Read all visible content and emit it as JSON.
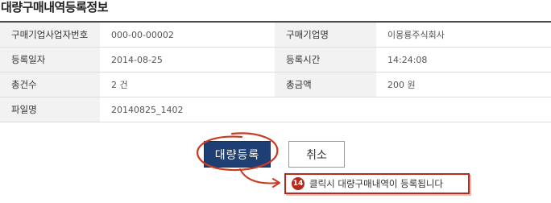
{
  "page": {
    "title": "대량구매내역등록정보"
  },
  "info": {
    "rows": [
      [
        {
          "label": "구매기업사업자번호",
          "value": "000-00-00002"
        },
        {
          "label": "구매기업명",
          "value": "이몽룡주식회사"
        }
      ],
      [
        {
          "label": "등록일자",
          "value": "2014-08-25"
        },
        {
          "label": "등록시간",
          "value": "14:24:08"
        }
      ],
      [
        {
          "label": "총건수",
          "value": "2 건"
        },
        {
          "label": "총금액",
          "value": "200 원"
        }
      ],
      [
        {
          "label": "파일명",
          "value": "20140825_1402"
        }
      ]
    ]
  },
  "actions": {
    "register_label": "대량등록",
    "cancel_label": "취소"
  },
  "annotation": {
    "step_number": "14",
    "text": "클릭시 대량구매내역이 등록됩니다",
    "color": "#b52a1c"
  },
  "colors": {
    "primary_button": "#1d3f73",
    "label_background": "#f2f2f2"
  }
}
